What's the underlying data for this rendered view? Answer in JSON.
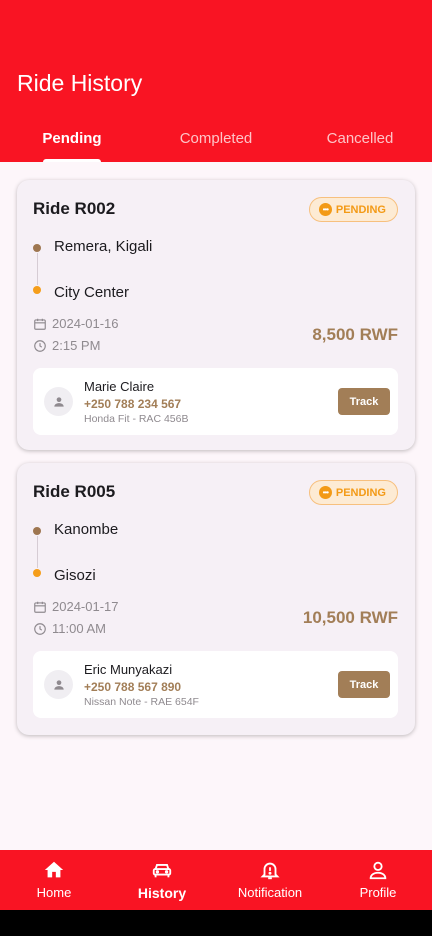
{
  "header": {
    "title": "Ride History"
  },
  "tabs": [
    {
      "label": "Pending",
      "active": true
    },
    {
      "label": "Completed",
      "active": false
    },
    {
      "label": "Cancelled",
      "active": false
    }
  ],
  "rides": [
    {
      "id": "Ride R002",
      "status": "PENDING",
      "from": "Remera, Kigali",
      "to": "City Center",
      "date": "2024-01-16",
      "time": "2:15 PM",
      "fare": "8,500 RWF",
      "driver": {
        "name": "Marie Claire",
        "phone": "+250 788 234 567",
        "vehicle": "Honda Fit - RAC 456B"
      },
      "action_label": "Track"
    },
    {
      "id": "Ride R005",
      "status": "PENDING",
      "from": "Kanombe",
      "to": "Gisozi",
      "date": "2024-01-17",
      "time": "11:00 AM",
      "fare": "10,500 RWF",
      "driver": {
        "name": "Eric Munyakazi",
        "phone": "+250 788 567 890",
        "vehicle": "Nissan Note - RAE 654F"
      },
      "action_label": "Track"
    }
  ],
  "bottom_nav": [
    {
      "label": "Home",
      "icon": "home-icon",
      "active": false
    },
    {
      "label": "History",
      "icon": "car-icon",
      "active": true
    },
    {
      "label": "Notification",
      "icon": "bell-icon",
      "active": false
    },
    {
      "label": "Profile",
      "icon": "person-icon",
      "active": false
    }
  ],
  "colors": {
    "primary": "#f91423",
    "accent_brown": "#a27e57",
    "pending_orange": "#f39a16",
    "card_bg": "#f6f0f6"
  }
}
